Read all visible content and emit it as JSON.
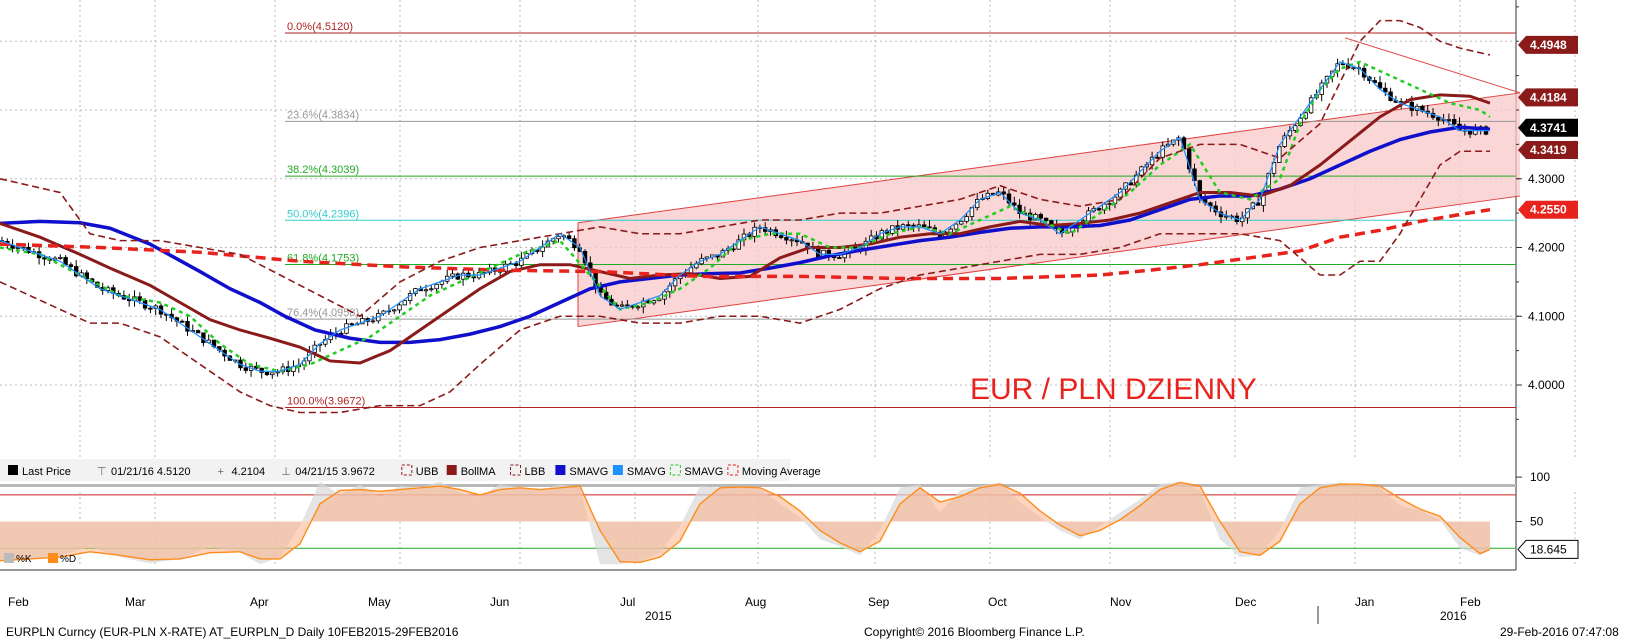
{
  "chart_data": {
    "type": "line",
    "title": "EUR / PLN DZIENNY",
    "title_color": "#e8231e",
    "ylim": [
      3.92,
      4.56
    ],
    "y_ticks": [
      "4.3000",
      "4.2000",
      "4.1000",
      "4.0000"
    ],
    "y_tick_values": [
      4.3,
      4.2,
      4.1,
      4.0
    ],
    "x_months": [
      "Feb",
      "Mar",
      "Apr",
      "May",
      "Jun",
      "Jul",
      "Aug",
      "Sep",
      "Oct",
      "Nov",
      "Dec",
      "Jan",
      "Feb"
    ],
    "x_years": [
      "2015",
      "2016"
    ],
    "price_tags": [
      {
        "label": "4.4948",
        "value": 4.4948,
        "color": "#8b1a1a"
      },
      {
        "label": "4.4184",
        "value": 4.4184,
        "color": "#8b1a1a"
      },
      {
        "label": "4.3741",
        "value": 4.3741,
        "color": "#000000"
      },
      {
        "label": "4.3419",
        "value": 4.3419,
        "color": "#8b1a1a"
      },
      {
        "label": "4.2550",
        "value": 4.255,
        "color": "#e8231e"
      }
    ],
    "fib_levels": [
      {
        "label": "0.0%(4.5120)",
        "value": 4.512,
        "color": "#b22222"
      },
      {
        "label": "23.6%(4.3834)",
        "value": 4.3834,
        "color": "#999999"
      },
      {
        "label": "38.2%(4.3039)",
        "value": 4.3039,
        "color": "#22aa22"
      },
      {
        "label": "50.0%(4.2396)",
        "value": 4.2396,
        "color": "#33cccc"
      },
      {
        "label": "61.8%(4.1753)",
        "value": 4.1753,
        "color": "#22aa22"
      },
      {
        "label": "76.4%(4.0958)",
        "value": 4.0958,
        "color": "#999999"
      },
      {
        "label": "100.0%(3.9672)",
        "value": 3.9672,
        "color": "#b22222"
      }
    ],
    "legend": [
      {
        "label": "Last Price",
        "color": "#000000",
        "style": "box"
      },
      {
        "label": "01/21/16 4.5120",
        "color": "#666666",
        "style": "hi"
      },
      {
        "label": "4.2104",
        "color": "#666666",
        "style": "plus"
      },
      {
        "label": "04/21/15 3.9672",
        "color": "#666666",
        "style": "lo"
      },
      {
        "label": "UBB",
        "color": "#8b1a1a",
        "style": "dash"
      },
      {
        "label": "BollMA",
        "color": "#8b1a1a",
        "style": "box"
      },
      {
        "label": "LBB",
        "color": "#8b1a1a",
        "style": "dash"
      },
      {
        "label": "SMAVG",
        "color": "#1010cc",
        "style": "box"
      },
      {
        "label": "SMAVG",
        "color": "#1e90ff",
        "style": "box"
      },
      {
        "label": "SMAVG",
        "color": "#22cc22",
        "style": "dash"
      },
      {
        "label": "Moving Average",
        "color": "#e8231e",
        "style": "dash"
      }
    ],
    "series": [
      {
        "name": "SMAVG",
        "color": "#1010cc",
        "x": [
          0,
          40,
          80,
          110,
          150,
          175,
          200,
          230,
          260,
          285,
          315,
          350,
          380,
          410,
          440,
          470,
          500,
          530,
          560,
          590,
          620,
          650,
          680,
          710,
          740,
          770,
          800,
          830,
          860,
          890,
          920,
          950,
          980,
          1010,
          1040,
          1070,
          1100,
          1130,
          1160,
          1190,
          1220,
          1250,
          1280,
          1310,
          1340,
          1370,
          1400,
          1430,
          1460,
          1490
        ],
        "values": [
          4.235,
          4.238,
          4.236,
          4.228,
          4.205,
          4.185,
          4.165,
          4.14,
          4.12,
          4.1,
          4.08,
          4.068,
          4.062,
          4.062,
          4.066,
          4.074,
          4.085,
          4.1,
          4.12,
          4.14,
          4.15,
          4.155,
          4.16,
          4.162,
          4.163,
          4.17,
          4.178,
          4.188,
          4.196,
          4.203,
          4.21,
          4.215,
          4.222,
          4.228,
          4.23,
          4.23,
          4.232,
          4.24,
          4.255,
          4.27,
          4.275,
          4.275,
          4.285,
          4.3,
          4.32,
          4.34,
          4.357,
          4.368,
          4.375,
          4.372
        ]
      },
      {
        "name": "BollMA",
        "color": "#8b1a1a",
        "x": [
          0,
          40,
          80,
          110,
          150,
          180,
          210,
          240,
          270,
          300,
          330,
          360,
          390,
          420,
          450,
          480,
          510,
          540,
          570,
          600,
          630,
          660,
          690,
          720,
          750,
          780,
          810,
          840,
          870,
          900,
          930,
          960,
          990,
          1020,
          1050,
          1080,
          1110,
          1140,
          1170,
          1200,
          1230,
          1260,
          1290,
          1320,
          1350,
          1380,
          1410,
          1440,
          1470,
          1490
        ],
        "values": [
          4.235,
          4.215,
          4.19,
          4.17,
          4.145,
          4.12,
          4.095,
          4.08,
          4.068,
          4.055,
          4.035,
          4.032,
          4.05,
          4.08,
          4.11,
          4.14,
          4.165,
          4.175,
          4.175,
          4.165,
          4.155,
          4.16,
          4.162,
          4.155,
          4.158,
          4.185,
          4.2,
          4.2,
          4.205,
          4.215,
          4.22,
          4.22,
          4.23,
          4.238,
          4.232,
          4.235,
          4.24,
          4.25,
          4.265,
          4.28,
          4.28,
          4.275,
          4.29,
          4.32,
          4.355,
          4.39,
          4.415,
          4.422,
          4.42,
          4.41
        ]
      },
      {
        "name": "Moving Average",
        "color": "#e8231e",
        "x": [
          0,
          100,
          200,
          300,
          400,
          500,
          600,
          700,
          800,
          900,
          1000,
          1100,
          1150,
          1200,
          1250,
          1300,
          1340,
          1380,
          1420,
          1460,
          1490
        ],
        "values": [
          4.205,
          4.2,
          4.193,
          4.18,
          4.172,
          4.167,
          4.165,
          4.158,
          4.158,
          4.155,
          4.155,
          4.16,
          4.167,
          4.175,
          4.185,
          4.195,
          4.215,
          4.225,
          4.238,
          4.248,
          4.255
        ]
      },
      {
        "name": "SMAVG",
        "color": "#22cc22",
        "x": [
          0,
          40,
          80,
          120,
          160,
          190,
          220,
          250,
          280,
          310,
          340,
          370,
          400,
          430,
          460,
          490,
          520,
          560,
          590,
          620,
          650,
          680,
          710,
          740,
          770,
          800,
          830,
          860,
          890,
          920,
          950,
          980,
          1010,
          1040,
          1070,
          1100,
          1130,
          1160,
          1190,
          1220,
          1250,
          1280,
          1300,
          1320,
          1340,
          1360,
          1390,
          1420,
          1450,
          1480,
          1490
        ],
        "values": [
          4.2,
          4.19,
          4.16,
          4.13,
          4.12,
          4.1,
          4.06,
          4.03,
          4.02,
          4.03,
          4.05,
          4.07,
          4.1,
          4.13,
          4.15,
          4.17,
          4.19,
          4.21,
          4.16,
          4.11,
          4.12,
          4.14,
          4.17,
          4.21,
          4.22,
          4.22,
          4.2,
          4.2,
          4.22,
          4.23,
          4.22,
          4.24,
          4.26,
          4.24,
          4.22,
          4.25,
          4.28,
          4.32,
          4.35,
          4.28,
          4.27,
          4.3,
          4.38,
          4.43,
          4.46,
          4.47,
          4.45,
          4.43,
          4.41,
          4.4,
          4.39
        ]
      },
      {
        "name": "UBB",
        "color": "#8b1a1a",
        "x": [
          0,
          30,
          60,
          90,
          120,
          160,
          200,
          240,
          280,
          320,
          360,
          400,
          440,
          480,
          520,
          560,
          600,
          640,
          680,
          720,
          760,
          800,
          840,
          880,
          920,
          960,
          1000,
          1040,
          1080,
          1120,
          1160,
          1200,
          1240,
          1280,
          1320,
          1360,
          1380,
          1400,
          1420,
          1440,
          1460,
          1490
        ],
        "values": [
          4.3,
          4.29,
          4.28,
          4.22,
          4.21,
          4.21,
          4.2,
          4.19,
          4.16,
          4.13,
          4.1,
          4.15,
          4.18,
          4.2,
          4.21,
          4.22,
          4.23,
          4.22,
          4.22,
          4.23,
          4.24,
          4.24,
          4.25,
          4.25,
          4.26,
          4.27,
          4.29,
          4.27,
          4.26,
          4.27,
          4.33,
          4.35,
          4.35,
          4.33,
          4.38,
          4.5,
          4.53,
          4.53,
          4.52,
          4.5,
          4.49,
          4.48
        ]
      },
      {
        "name": "LBB",
        "color": "#8b1a1a",
        "x": [
          0,
          30,
          60,
          90,
          120,
          160,
          200,
          240,
          270,
          300,
          340,
          380,
          420,
          450,
          480,
          520,
          560,
          600,
          640,
          680,
          720,
          760,
          800,
          840,
          880,
          920,
          960,
          1000,
          1040,
          1080,
          1120,
          1160,
          1200,
          1240,
          1280,
          1320,
          1340,
          1360,
          1380,
          1400,
          1420,
          1440,
          1460,
          1490
        ],
        "values": [
          4.15,
          4.13,
          4.11,
          4.09,
          4.09,
          4.07,
          4.03,
          3.99,
          3.97,
          3.96,
          3.96,
          3.97,
          3.97,
          3.99,
          4.03,
          4.08,
          4.1,
          4.1,
          4.09,
          4.09,
          4.1,
          4.1,
          4.09,
          4.11,
          4.14,
          4.16,
          4.17,
          4.18,
          4.19,
          4.19,
          4.2,
          4.22,
          4.22,
          4.22,
          4.21,
          4.16,
          4.16,
          4.18,
          4.18,
          4.22,
          4.27,
          4.32,
          4.34,
          4.34
        ]
      },
      {
        "name": "SMAVG",
        "color": "#1e90ff",
        "x": [
          0,
          20,
          40,
          60,
          80,
          100,
          120,
          140,
          160,
          180,
          200,
          220,
          240,
          260,
          280,
          300,
          320,
          340,
          360,
          380,
          400,
          420,
          440,
          460,
          480,
          500,
          520,
          540,
          560,
          580,
          600,
          620,
          640,
          660,
          680,
          700,
          720,
          740,
          760,
          780,
          800,
          820,
          840,
          860,
          880,
          900,
          920,
          940,
          960,
          980,
          1000,
          1020,
          1040,
          1060,
          1080,
          1100,
          1120,
          1140,
          1160,
          1180,
          1200,
          1220,
          1240,
          1260,
          1280,
          1300,
          1320,
          1340,
          1360,
          1380,
          1400,
          1420,
          1440,
          1460,
          1480,
          1490
        ],
        "values": [
          4.21,
          4.2,
          4.19,
          4.18,
          4.16,
          4.14,
          4.13,
          4.12,
          4.11,
          4.09,
          4.07,
          4.05,
          4.03,
          4.02,
          4.02,
          4.03,
          4.06,
          4.08,
          4.09,
          4.1,
          4.12,
          4.14,
          4.15,
          4.16,
          4.16,
          4.17,
          4.18,
          4.2,
          4.22,
          4.2,
          4.13,
          4.11,
          4.12,
          4.13,
          4.16,
          4.18,
          4.19,
          4.21,
          4.23,
          4.22,
          4.21,
          4.19,
          4.19,
          4.2,
          4.22,
          4.23,
          4.23,
          4.22,
          4.24,
          4.27,
          4.28,
          4.25,
          4.24,
          4.22,
          4.24,
          4.26,
          4.28,
          4.31,
          4.34,
          4.36,
          4.27,
          4.25,
          4.24,
          4.27,
          4.35,
          4.39,
          4.43,
          4.47,
          4.46,
          4.43,
          4.41,
          4.4,
          4.39,
          4.37,
          4.37,
          4.37
        ]
      }
    ],
    "channel": {
      "upper": [
        [
          578,
          4.236
        ],
        [
          1520,
          4.425
        ]
      ],
      "lower": [
        [
          578,
          4.085
        ],
        [
          1520,
          4.275
        ]
      ]
    },
    "trendline": [
      [
        1345,
        4.505
      ],
      [
        1520,
        4.425
      ]
    ],
    "stoch": {
      "ylim": [
        0,
        108
      ],
      "y_ticks": [
        "100",
        "50"
      ],
      "y_tick_values": [
        100,
        50
      ],
      "reference_lines": [
        {
          "value": 80,
          "color": "#cc2222"
        },
        {
          "value": 20,
          "color": "#22aa22"
        }
      ],
      "readout": "18.645",
      "legend": [
        {
          "label": "%K",
          "color": "#bbbbbb"
        },
        {
          "label": "%D",
          "color": "#ff8c1a"
        }
      ],
      "k": {
        "x": [
          0,
          30,
          60,
          90,
          120,
          150,
          180,
          210,
          240,
          260,
          280,
          300,
          320,
          340,
          360,
          380,
          400,
          420,
          440,
          460,
          480,
          500,
          520,
          540,
          560,
          580,
          600,
          620,
          640,
          660,
          680,
          700,
          720,
          740,
          760,
          780,
          800,
          820,
          840,
          860,
          880,
          900,
          920,
          940,
          960,
          980,
          1000,
          1020,
          1040,
          1060,
          1080,
          1100,
          1120,
          1140,
          1160,
          1180,
          1200,
          1220,
          1240,
          1260,
          1280,
          1300,
          1320,
          1340,
          1360,
          1380,
          1400,
          1420,
          1440,
          1460,
          1480,
          1490
        ],
        "values": [
          5,
          8,
          12,
          22,
          10,
          3,
          8,
          22,
          15,
          2,
          10,
          45,
          95,
          80,
          92,
          78,
          90,
          88,
          95,
          82,
          78,
          92,
          88,
          85,
          92,
          88,
          2,
          2,
          5,
          15,
          45,
          90,
          88,
          90,
          86,
          70,
          55,
          30,
          22,
          12,
          40,
          88,
          92,
          60,
          85,
          90,
          94,
          72,
          55,
          40,
          30,
          45,
          60,
          75,
          92,
          95,
          85,
          30,
          10,
          12,
          40,
          88,
          92,
          94,
          92,
          88,
          68,
          62,
          52,
          20,
          12,
          18
        ]
      },
      "d": {
        "x": [
          0,
          30,
          60,
          90,
          120,
          150,
          180,
          210,
          240,
          260,
          280,
          300,
          320,
          340,
          360,
          380,
          400,
          420,
          440,
          460,
          480,
          500,
          520,
          540,
          560,
          580,
          600,
          620,
          640,
          660,
          680,
          700,
          720,
          740,
          760,
          780,
          800,
          820,
          840,
          860,
          880,
          900,
          920,
          940,
          960,
          980,
          1000,
          1020,
          1040,
          1060,
          1080,
          1100,
          1120,
          1140,
          1160,
          1180,
          1200,
          1220,
          1240,
          1260,
          1280,
          1300,
          1320,
          1340,
          1360,
          1380,
          1400,
          1420,
          1440,
          1460,
          1480,
          1490
        ],
        "values": [
          6,
          8,
          10,
          16,
          12,
          7,
          8,
          15,
          16,
          8,
          8,
          25,
          70,
          85,
          86,
          84,
          86,
          88,
          90,
          86,
          80,
          86,
          88,
          86,
          88,
          90,
          40,
          5,
          4,
          10,
          28,
          70,
          88,
          89,
          88,
          78,
          62,
          40,
          26,
          16,
          28,
          70,
          88,
          72,
          78,
          88,
          92,
          82,
          62,
          46,
          34,
          40,
          52,
          68,
          86,
          94,
          90,
          50,
          16,
          12,
          28,
          70,
          88,
          92,
          92,
          90,
          76,
          64,
          56,
          32,
          14,
          18.6
        ]
      }
    },
    "footer": {
      "left": "EURPLN Curncy (EUR-PLN X-RATE) AT_EURPLN_D  Daily 10FEB2015-29FEB2016",
      "center": "Copyright© 2016 Bloomberg Finance L.P.",
      "right": "29-Feb-2016 07:47:08"
    }
  }
}
